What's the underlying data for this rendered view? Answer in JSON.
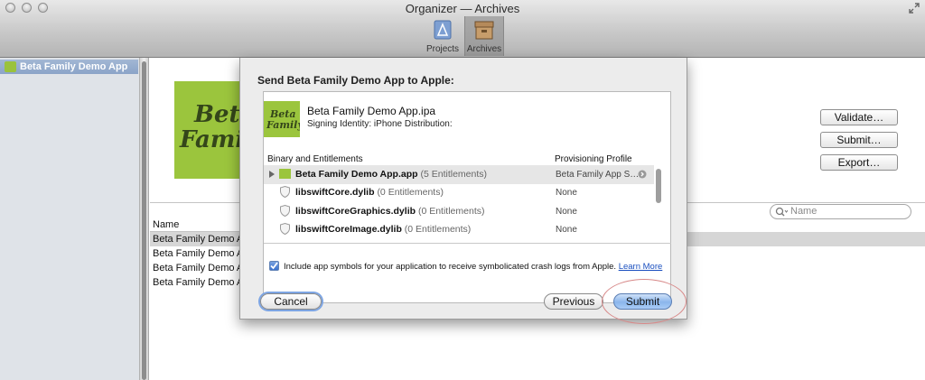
{
  "window": {
    "title": "Organizer — Archives"
  },
  "toolbar": {
    "projects_label": "Projects",
    "archives_label": "Archives"
  },
  "sidebar": {
    "items": [
      {
        "label": "Beta Family Demo App"
      }
    ]
  },
  "app_logo": {
    "line1": "Beta",
    "line2": "Family",
    "brand_color": "#9bc53d"
  },
  "actions": {
    "validate_label": "Validate…",
    "submit_label": "Submit…",
    "export_label": "Export…"
  },
  "search": {
    "placeholder": "Name"
  },
  "archives_table": {
    "column_name": "Name",
    "rows": [
      {
        "name": "Beta Family Demo App"
      },
      {
        "name": "Beta Family Demo App"
      },
      {
        "name": "Beta Family Demo App"
      },
      {
        "name": "Beta Family Demo App"
      }
    ]
  },
  "sheet": {
    "title": "Send Beta Family Demo App to Apple:",
    "ipa_name": "Beta Family Demo App.ipa",
    "signing_identity": "Signing Identity: iPhone Distribution:",
    "col_binary": "Binary and Entitlements",
    "col_profile": "Provisioning Profile",
    "rows": [
      {
        "name": "Beta Family Demo App.app",
        "entitlements": "(5 Entitlements)",
        "profile": "Beta Family App S…"
      },
      {
        "name": "libswiftCore.dylib",
        "entitlements": "(0 Entitlements)",
        "profile": "None"
      },
      {
        "name": "libswiftCoreGraphics.dylib",
        "entitlements": "(0 Entitlements)",
        "profile": "None"
      },
      {
        "name": "libswiftCoreImage.dylib",
        "entitlements": "(0 Entitlements)",
        "profile": "None"
      }
    ],
    "checkbox_label": "Include app symbols for your application to receive symbolicated crash logs from Apple.",
    "learn_more": "Learn More",
    "checkbox_checked": true,
    "cancel_label": "Cancel",
    "previous_label": "Previous",
    "submit_label": "Submit"
  }
}
